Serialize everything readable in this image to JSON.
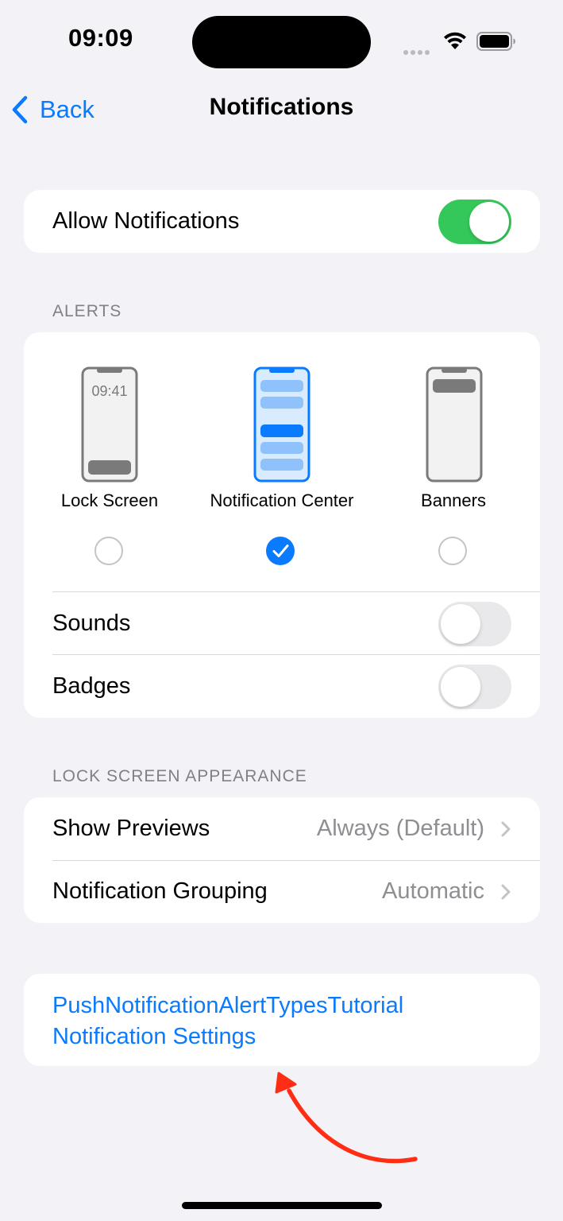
{
  "status_bar": {
    "time": "09:09",
    "phone_mockup_time": "09:41"
  },
  "nav": {
    "back_label": "Back",
    "title": "Notifications"
  },
  "allow_notifications": {
    "label": "Allow Notifications",
    "enabled": true
  },
  "alerts": {
    "header": "ALERTS",
    "styles": [
      {
        "label": "Lock Screen",
        "selected": false
      },
      {
        "label": "Notification Center",
        "selected": true
      },
      {
        "label": "Banners",
        "selected": false
      }
    ],
    "sounds": {
      "label": "Sounds",
      "enabled": false
    },
    "badges": {
      "label": "Badges",
      "enabled": false
    }
  },
  "lock_screen_appearance": {
    "header": "LOCK SCREEN APPEARANCE",
    "show_previews": {
      "label": "Show Previews",
      "value": "Always (Default)"
    },
    "notification_grouping": {
      "label": "Notification Grouping",
      "value": "Automatic"
    }
  },
  "app_settings_link": {
    "line1": "PushNotificationAlertTypesTutorial",
    "line2": "Notification Settings"
  },
  "colors": {
    "accent": "#0a7aff",
    "toggle_on": "#34c759",
    "annotation_arrow": "#ff2d13"
  }
}
